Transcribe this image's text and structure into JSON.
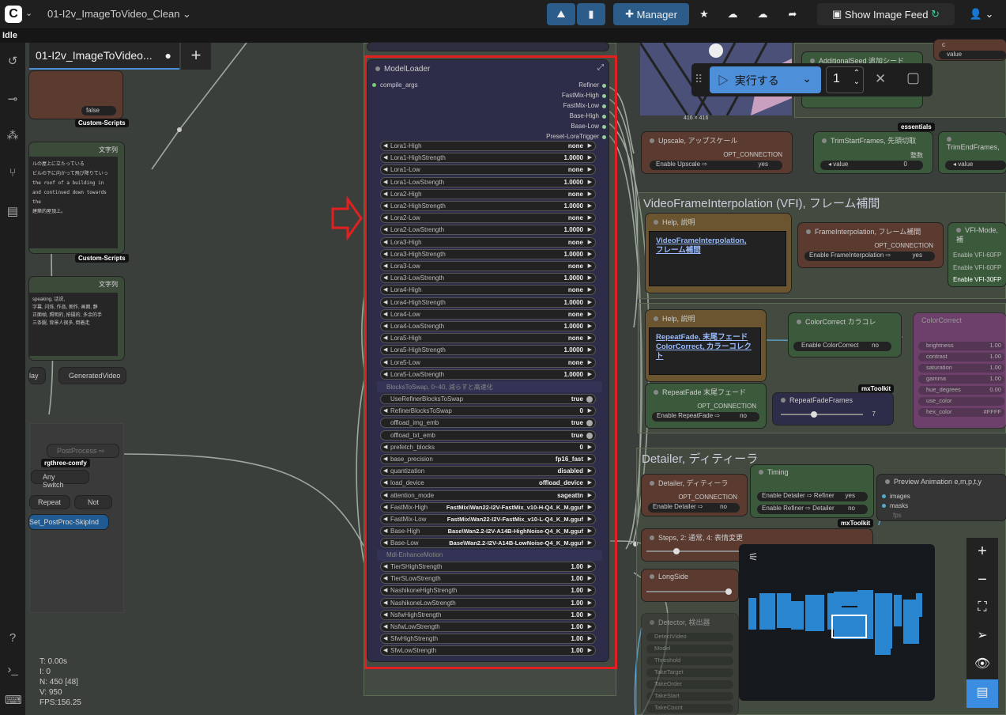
{
  "topbar": {
    "workflow": "01-I2v_ImageToVideo_Clean",
    "manager": "Manager",
    "show_feed": "Show Image Feed"
  },
  "status": "Idle",
  "tab": {
    "label": "01-I2v_ImageToVideo..."
  },
  "stats": [
    "T: 0.00s",
    "I: 0",
    "N: 450 [48]",
    "V: 950",
    "FPS:156.25"
  ],
  "run": {
    "label": "実行する",
    "count": "1"
  },
  "model_loader": {
    "title": "ModelLoader",
    "input": "compile_args",
    "outputs": [
      "Refiner",
      "FastMix-High",
      "FastMix-Low",
      "Base-High",
      "Base-Low",
      "Preset-LoraTrigger"
    ],
    "rows": [
      {
        "l": "Lora1-High",
        "v": "none"
      },
      {
        "l": "Lora1-HighStrength",
        "v": "1.0000"
      },
      {
        "l": "Lora1-Low",
        "v": "none"
      },
      {
        "l": "Lora1-LowStrength",
        "v": "1.0000"
      },
      {
        "l": "Lora2-High",
        "v": "none"
      },
      {
        "l": "Lora2-HighStrength",
        "v": "1.0000"
      },
      {
        "l": "Lora2-Low",
        "v": "none"
      },
      {
        "l": "Lora2-LowStrength",
        "v": "1.0000"
      },
      {
        "l": "Lora3-High",
        "v": "none"
      },
      {
        "l": "Lora3-HighStrength",
        "v": "1.0000"
      },
      {
        "l": "Lora3-Low",
        "v": "none"
      },
      {
        "l": "Lora3-LowStrength",
        "v": "1.0000"
      },
      {
        "l": "Lora4-High",
        "v": "none"
      },
      {
        "l": "Lora4-HighStrength",
        "v": "1.0000"
      },
      {
        "l": "Lora4-Low",
        "v": "none"
      },
      {
        "l": "Lora4-LowStrength",
        "v": "1.0000"
      },
      {
        "l": "Lora5-High",
        "v": "none"
      },
      {
        "l": "Lora5-HighStrength",
        "v": "1.0000"
      },
      {
        "l": "Lora5-Low",
        "v": "none"
      },
      {
        "l": "Lora5-LowStrength",
        "v": "1.0000"
      }
    ],
    "section1": "BlocksToSwap, 0~40, 減らすと高速化",
    "rows2": [
      {
        "l": "UseRefinerBlocksToSwap",
        "v": "true"
      },
      {
        "l": "RefinerBlocksToSwap",
        "v": "0"
      },
      {
        "l": "offload_img_emb",
        "v": "true"
      },
      {
        "l": "offload_txt_emb",
        "v": "true"
      },
      {
        "l": "prefetch_blocks",
        "v": "0"
      },
      {
        "l": "base_precision",
        "v": "fp16_fast"
      },
      {
        "l": "quantization",
        "v": "disabled"
      },
      {
        "l": "load_device",
        "v": "offload_device"
      },
      {
        "l": "attention_mode",
        "v": "sageattn"
      },
      {
        "l": "FastMix-High",
        "v": "FastMix\\Wan22-I2V-FastMix_v10-H-Q4_K_M.gguf"
      },
      {
        "l": "FastMix-Low",
        "v": "FastMix\\Wan22-I2V-FastMix_v10-L-Q4_K_M.gguf"
      },
      {
        "l": "Base-High",
        "v": "Base\\Wan2.2-I2V-A14B-HighNoise-Q4_K_M.gguf"
      },
      {
        "l": "Base-Low",
        "v": "Base\\Wan2.2-I2V-A14B-LowNoise-Q4_K_M.gguf"
      }
    ],
    "section2": "Mdl-EnhanceMotion",
    "rows3": [
      {
        "l": "TierSHighStrength",
        "v": "1.00"
      },
      {
        "l": "TierSLowStrength",
        "v": "1.00"
      },
      {
        "l": "NashikoneHighStrength",
        "v": "1.00"
      },
      {
        "l": "NashikoneLowStrength",
        "v": "1.00"
      },
      {
        "l": "NsfwHighStrength",
        "v": "1.00"
      },
      {
        "l": "NsfwLowStrength",
        "v": "1.00"
      },
      {
        "l": "SfwHighStrength",
        "v": "1.00"
      },
      {
        "l": "SfwLowStrength",
        "v": "1.00"
      }
    ]
  },
  "right": {
    "upscale_title": "Upscale, アップスケール",
    "opt": "OPT_CONNECTION",
    "enable_upscale": "Enable Upscale ⇨",
    "yes": "yes",
    "no": "no",
    "trimstart": "TrimStartFrames, 先頭切取",
    "trimend": "TrimEndFrames,",
    "value": "value",
    "zero": "0",
    "seisu": "整数",
    "essentials": "essentials",
    "vfi_group": "VideoFrameInterpolation (VFI), フレーム補間",
    "help": "Help, 説明",
    "help1a": "VideoFrameInterpolation",
    "help1b": "フレーム補間",
    "fi_title": "FrameInterpolation, フレーム補間",
    "enable_fi": "Enable FrameInterpolation ⇨",
    "vfi_mode": "VFI-Mode, 補",
    "vfi1": "Enable VFI-60FP",
    "vfi2": "Enable VFI-60FP",
    "vfi3": "Enable VFI-30FP",
    "help2a": "RepeatFade",
    "help2b": "末尾フェード",
    "help2c": "ColorCorrect",
    "help2d": "カラーコレクト",
    "cc_title": "ColorCorrect カラコレ",
    "enable_cc": "Enable ColorCorrect",
    "cc2": "ColorCorrect",
    "cc_rows": [
      "brightness",
      "contrast",
      "saturation",
      "gamma",
      "hue_degrees",
      "use_color",
      "hex_color"
    ],
    "cc_vals": [
      "1.00",
      "1.00",
      "1.00",
      "1.00",
      "0.00",
      "",
      "#FFFF"
    ],
    "rf_title": "RepeatFade 末尾フェード",
    "enable_rf": "Enable RepeatFade ⇨",
    "mxtoolkit": "mxToolkit",
    "rff_title": "RepeatFadeFrames",
    "rff_val": "7",
    "detailer_group": "Detailer, ディティーラ",
    "det_title": "Detailer, ディティーラ",
    "enable_det": "Enable Detailer ⇨",
    "timing": "Timing",
    "enable_det_ref": "Enable Detailer ⇨ Refiner",
    "enable_ref_det": "Enable Refiner ⇨ Detailer",
    "preview": "Preview Animation e,m,p,t,y",
    "images": "images",
    "masks": "masks",
    "fps": "fps",
    "steps": "Steps, 2: 通常, 4: 表情変更",
    "longside": "LongSide",
    "detector": "Detector, 検出器",
    "det_rows": [
      "DetectVideo",
      "Model",
      "Threshold",
      "TakeTarget",
      "TakeOrder",
      "TakeStart",
      "TakeCount"
    ],
    "img_size": "416 × 416",
    "addseed": "AdditionalSeed 追加シード",
    "c": "c"
  },
  "left": {
    "false": "false",
    "custom_scripts": "Custom-Scripts",
    "string": "文字列",
    "text1": [
      "ルの屋上に立たっている",
      "ビルの下に向かって飛び降りていっ",
      "the roof of a building in",
      "and continued down towards the",
      "建築的屋頂上。"
    ],
    "text2": [
      "speaking, 话说,",
      "字幕, 闪烁, 作品, 图作, 画面, 静",
      "正面帧, 照明的, 拍摄的, 多余的手",
      "三条腿, 背景人很多, 倒着走"
    ],
    "play": "lay",
    "generated": "GeneratedVideo",
    "postprocess": "PostProcess ⇨",
    "rgthree": "rgthree-comfy",
    "anyswitch": "Any Switch",
    "repeat": "Repeat",
    "not": "Not",
    "setpost": "Set_PostProc-SkipInd"
  }
}
